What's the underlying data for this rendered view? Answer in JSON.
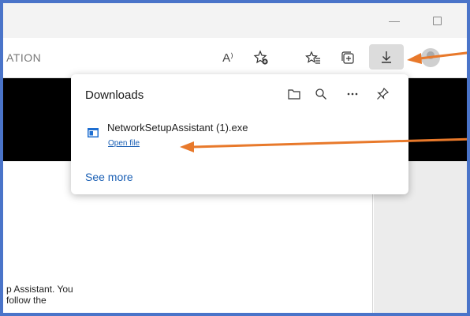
{
  "address_bar": {
    "text": "ATION"
  },
  "window_controls": {
    "minimize": "—"
  },
  "toolbar": {
    "read_aloud_label": "A⁾",
    "icons": [
      "read-aloud-icon",
      "add-favorite-icon",
      "favorites-icon",
      "collections-icon",
      "download-icon",
      "profile-avatar"
    ]
  },
  "downloads": {
    "title": "Downloads",
    "item": {
      "file_name": "NetworkSetupAssistant (1).exe",
      "action": "Open file"
    },
    "see_more": "See more"
  },
  "page": {
    "line1": "p Assistant. You",
    "line2": "follow the"
  },
  "colors": {
    "frame_border": "#4a74c9",
    "arrow": "#e8792b",
    "link": "#1a5fb4"
  }
}
